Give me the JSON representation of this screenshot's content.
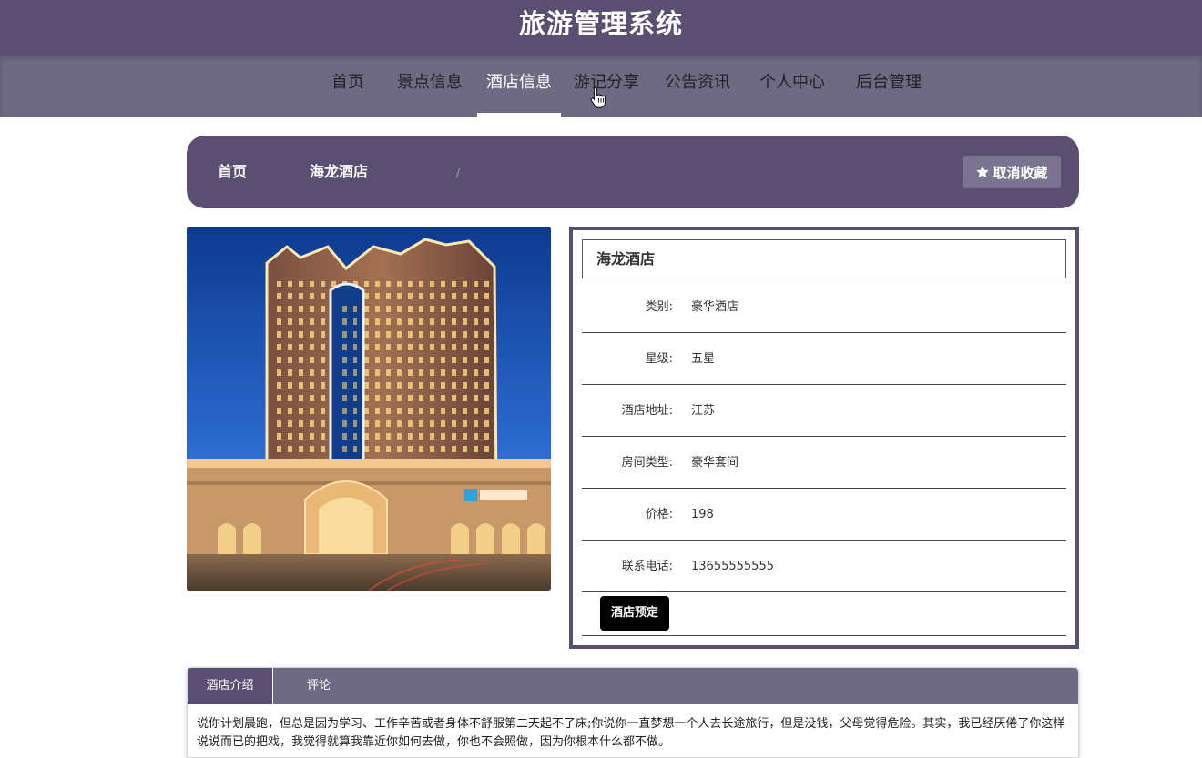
{
  "header": {
    "title": "旅游管理系统"
  },
  "nav": {
    "items": [
      {
        "label": "首页"
      },
      {
        "label": "景点信息"
      },
      {
        "label": "酒店信息",
        "active": true
      },
      {
        "label": "游记分享"
      },
      {
        "label": "公告资讯"
      },
      {
        "label": "个人中心"
      },
      {
        "label": "后台管理"
      }
    ]
  },
  "breadcrumb": {
    "home": "首页",
    "separator": "/",
    "current": "海龙酒店"
  },
  "actions": {
    "unfavorite_label": "取消收藏"
  },
  "hotel": {
    "name": "海龙酒店",
    "fields": [
      {
        "label": "类别:",
        "value": "豪华酒店"
      },
      {
        "label": "星级:",
        "value": "五星"
      },
      {
        "label": "酒店地址:",
        "value": "江苏"
      },
      {
        "label": "房间类型:",
        "value": "豪华套间"
      },
      {
        "label": "价格:",
        "value": "198"
      },
      {
        "label": "联系电话:",
        "value": "13655555555"
      }
    ],
    "book_label": "酒店预定"
  },
  "tabs": {
    "items": [
      {
        "label": "酒店介绍",
        "active": true
      },
      {
        "label": "评论"
      }
    ],
    "content": "说你计划晨跑，但总是因为学习、工作辛苦或者身体不舒服第二天起不了床;你说你一直梦想一个人去长途旅行，但是没钱，父母觉得危险。其实，我已经厌倦了你这样说说而已的把戏，我觉得就算我靠近你如何去做，你也不会照做，因为你根本什么都不做。"
  },
  "colors": {
    "primary": "#5a4f70",
    "secondary": "#6f6a84"
  }
}
